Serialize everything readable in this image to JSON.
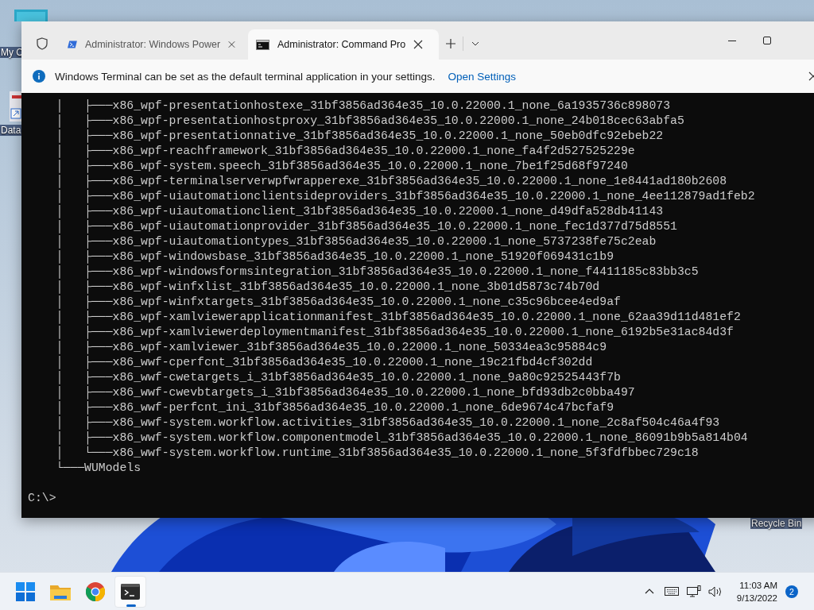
{
  "desktop": {
    "icons": [
      {
        "kind": "computer",
        "label": "My C"
      },
      {
        "kind": "shortcut",
        "label": "Data"
      },
      {
        "kind": "recycle-bin",
        "label": "Recycle Bin"
      }
    ]
  },
  "window": {
    "tabs": [
      {
        "kind": "powershell",
        "title": "Administrator: Windows Power",
        "selected": false
      },
      {
        "kind": "cmd",
        "title": "Administrator: Command Pro",
        "selected": true
      }
    ]
  },
  "info_bar": {
    "message": "Windows Terminal can be set as the default terminal application in your settings.",
    "link": "Open Settings"
  },
  "terminal": {
    "lines": [
      "    │   ├───x86_wpf-presentationhostexe_31bf3856ad364e35_10.0.22000.1_none_6a1935736c898073",
      "    │   ├───x86_wpf-presentationhostproxy_31bf3856ad364e35_10.0.22000.1_none_24b018cec63abfa5",
      "    │   ├───x86_wpf-presentationnative_31bf3856ad364e35_10.0.22000.1_none_50eb0dfc92ebeb22",
      "    │   ├───x86_wpf-reachframework_31bf3856ad364e35_10.0.22000.1_none_fa4f2d527525229e",
      "    │   ├───x86_wpf-system.speech_31bf3856ad364e35_10.0.22000.1_none_7be1f25d68f97240",
      "    │   ├───x86_wpf-terminalserverwpfwrapperexe_31bf3856ad364e35_10.0.22000.1_none_1e8441ad180b2608",
      "    │   ├───x86_wpf-uiautomationclientsideproviders_31bf3856ad364e35_10.0.22000.1_none_4ee112879ad1feb2",
      "    │   ├───x86_wpf-uiautomationclient_31bf3856ad364e35_10.0.22000.1_none_d49dfa528db41143",
      "    │   ├───x86_wpf-uiautomationprovider_31bf3856ad364e35_10.0.22000.1_none_fec1d377d75d8551",
      "    │   ├───x86_wpf-uiautomationtypes_31bf3856ad364e35_10.0.22000.1_none_5737238fe75c2eab",
      "    │   ├───x86_wpf-windowsbase_31bf3856ad364e35_10.0.22000.1_none_51920f069431c1b9",
      "    │   ├───x86_wpf-windowsformsintegration_31bf3856ad364e35_10.0.22000.1_none_f4411185c83bb3c5",
      "    │   ├───x86_wpf-winfxlist_31bf3856ad364e35_10.0.22000.1_none_3b01d5873c74b70d",
      "    │   ├───x86_wpf-winfxtargets_31bf3856ad364e35_10.0.22000.1_none_c35c96bcee4ed9af",
      "    │   ├───x86_wpf-xamlviewerapplicationmanifest_31bf3856ad364e35_10.0.22000.1_none_62aa39d11d481ef2",
      "    │   ├───x86_wpf-xamlviewerdeploymentmanifest_31bf3856ad364e35_10.0.22000.1_none_6192b5e31ac84d3f",
      "    │   ├───x86_wpf-xamlviewer_31bf3856ad364e35_10.0.22000.1_none_50334ea3c95884c9",
      "    │   ├───x86_wwf-cperfcnt_31bf3856ad364e35_10.0.22000.1_none_19c21fbd4cf302dd",
      "    │   ├───x86_wwf-cwetargets_i_31bf3856ad364e35_10.0.22000.1_none_9a80c92525443f7b",
      "    │   ├───x86_wwf-cwevbtargets_i_31bf3856ad364e35_10.0.22000.1_none_bfd93db2c0bba497",
      "    │   ├───x86_wwf-perfcnt_ini_31bf3856ad364e35_10.0.22000.1_none_6de9674c47bcfaf9",
      "    │   ├───x86_wwf-system.workflow.activities_31bf3856ad364e35_10.0.22000.1_none_2c8af504c46a4f93",
      "    │   ├───x86_wwf-system.workflow.componentmodel_31bf3856ad364e35_10.0.22000.1_none_86091b9b5a814b04",
      "    │   └───x86_wwf-system.workflow.runtime_31bf3856ad364e35_10.0.22000.1_none_5f3fdfbbec729c18",
      "    └───WUModels"
    ],
    "prompt": "C:\\>"
  },
  "taskbar": {
    "apps": [
      {
        "kind": "start",
        "selected": false
      },
      {
        "kind": "explorer",
        "selected": false
      },
      {
        "kind": "browser",
        "selected": false
      },
      {
        "kind": "terminal",
        "selected": true
      }
    ],
    "clock": {
      "time": "11:03 AM",
      "date": "9/13/2022"
    },
    "notifications": "2"
  }
}
